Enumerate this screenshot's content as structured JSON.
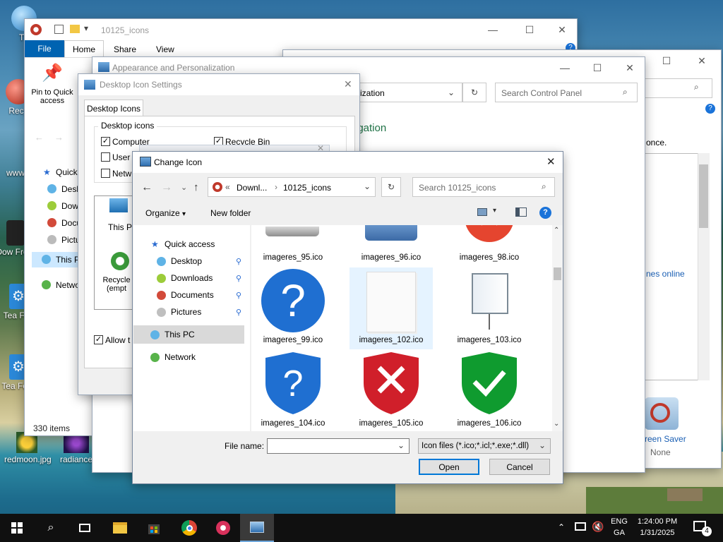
{
  "desktop": {
    "icons": [
      {
        "label": "Th"
      },
      {
        "label": "Recy"
      },
      {
        "label": "www"
      },
      {
        "label": "Dow From"
      },
      {
        "label": "Tea Fac"
      },
      {
        "label": "Tea Foru"
      },
      {
        "label": "redmoon.jpg"
      },
      {
        "label": "radiance"
      }
    ]
  },
  "explorer": {
    "title": "10125_icons",
    "ribbon_tabs": [
      "File",
      "Home",
      "Share",
      "View"
    ],
    "pin_label": "Pin to Quick access",
    "nav": [
      "Quick",
      "Desk",
      "Dow",
      "Docu",
      "Pictu",
      "This PC",
      "Netwo"
    ],
    "status": "330 items"
  },
  "control_panel_back": {
    "search_placeholder": "Search Control Panel",
    "text_once": "once.",
    "text_online": "nes online",
    "screensaver_label": "reen Saver",
    "screensaver_value": "None"
  },
  "control_panel": {
    "title": "Appearance and Personalization",
    "address_tail": "ization",
    "search_placeholder": "Search Control Panel",
    "heading_tail": "igation"
  },
  "desktop_icon_settings": {
    "title": "Desktop Icon Settings",
    "tab": "Desktop Icons",
    "group": "Desktop icons",
    "checks": [
      {
        "label": "Computer",
        "checked": true
      },
      {
        "label": "Recycle Bin",
        "checked": true
      },
      {
        "label": "User",
        "checked": false
      },
      {
        "label": "Netw",
        "checked": false
      }
    ],
    "preview_labels": [
      "This P",
      "Recycle (empt"
    ],
    "allow_label": "Allow t"
  },
  "change_icon": {
    "title": "Change Icon",
    "breadcrumb": [
      "Downl...",
      "10125_icons"
    ],
    "search_placeholder": "Search 10125_icons",
    "organize": "Organize",
    "new_folder": "New folder",
    "nav": [
      {
        "label": "Quick access",
        "icon": "star-icon",
        "color": "#2a6bd1"
      },
      {
        "label": "Desktop",
        "icon": "desktop-icon",
        "color": "#5fb3e6"
      },
      {
        "label": "Downloads",
        "icon": "downloads-icon",
        "color": "#9ccc3a"
      },
      {
        "label": "Documents",
        "icon": "documents-icon",
        "color": "#d24a3a"
      },
      {
        "label": "Pictures",
        "icon": "pictures-icon",
        "color": "#bfbfbf"
      },
      {
        "label": "This PC",
        "icon": "this-pc-icon",
        "color": "#5fb3e6"
      },
      {
        "label": "Network",
        "icon": "network-icon",
        "color": "#58b34a"
      }
    ],
    "files": [
      {
        "name": "imageres_95.ico",
        "icon": "drive-icon"
      },
      {
        "name": "imageres_96.ico",
        "icon": "monitor-icon"
      },
      {
        "name": "imageres_98.ico",
        "icon": "red-x-icon"
      },
      {
        "name": "imageres_99.ico",
        "icon": "blue-help-circle-icon"
      },
      {
        "name": "imageres_102.ico",
        "icon": "blank-document-icon"
      },
      {
        "name": "imageres_103.ico",
        "icon": "projector-screen-icon"
      },
      {
        "name": "imageres_104.ico",
        "icon": "blue-help-shield-icon"
      },
      {
        "name": "imageres_105.ico",
        "icon": "red-x-shield-icon"
      },
      {
        "name": "imageres_106.ico",
        "icon": "green-check-shield-icon"
      }
    ],
    "filename_label": "File name:",
    "filename_value": "",
    "filetype": "Icon files (*.ico;*.icl;*.exe;*.dll)",
    "open": "Open",
    "cancel": "Cancel"
  },
  "taskbar": {
    "lang": [
      "ENG",
      "GA"
    ],
    "time": "1:24:00 PM",
    "date": "1/31/2025",
    "notifications": "4"
  },
  "colors": {
    "accent": "#0078d7",
    "selection": "#cce8ff",
    "taskbar": "#101010",
    "green_heading": "#1e7145"
  }
}
